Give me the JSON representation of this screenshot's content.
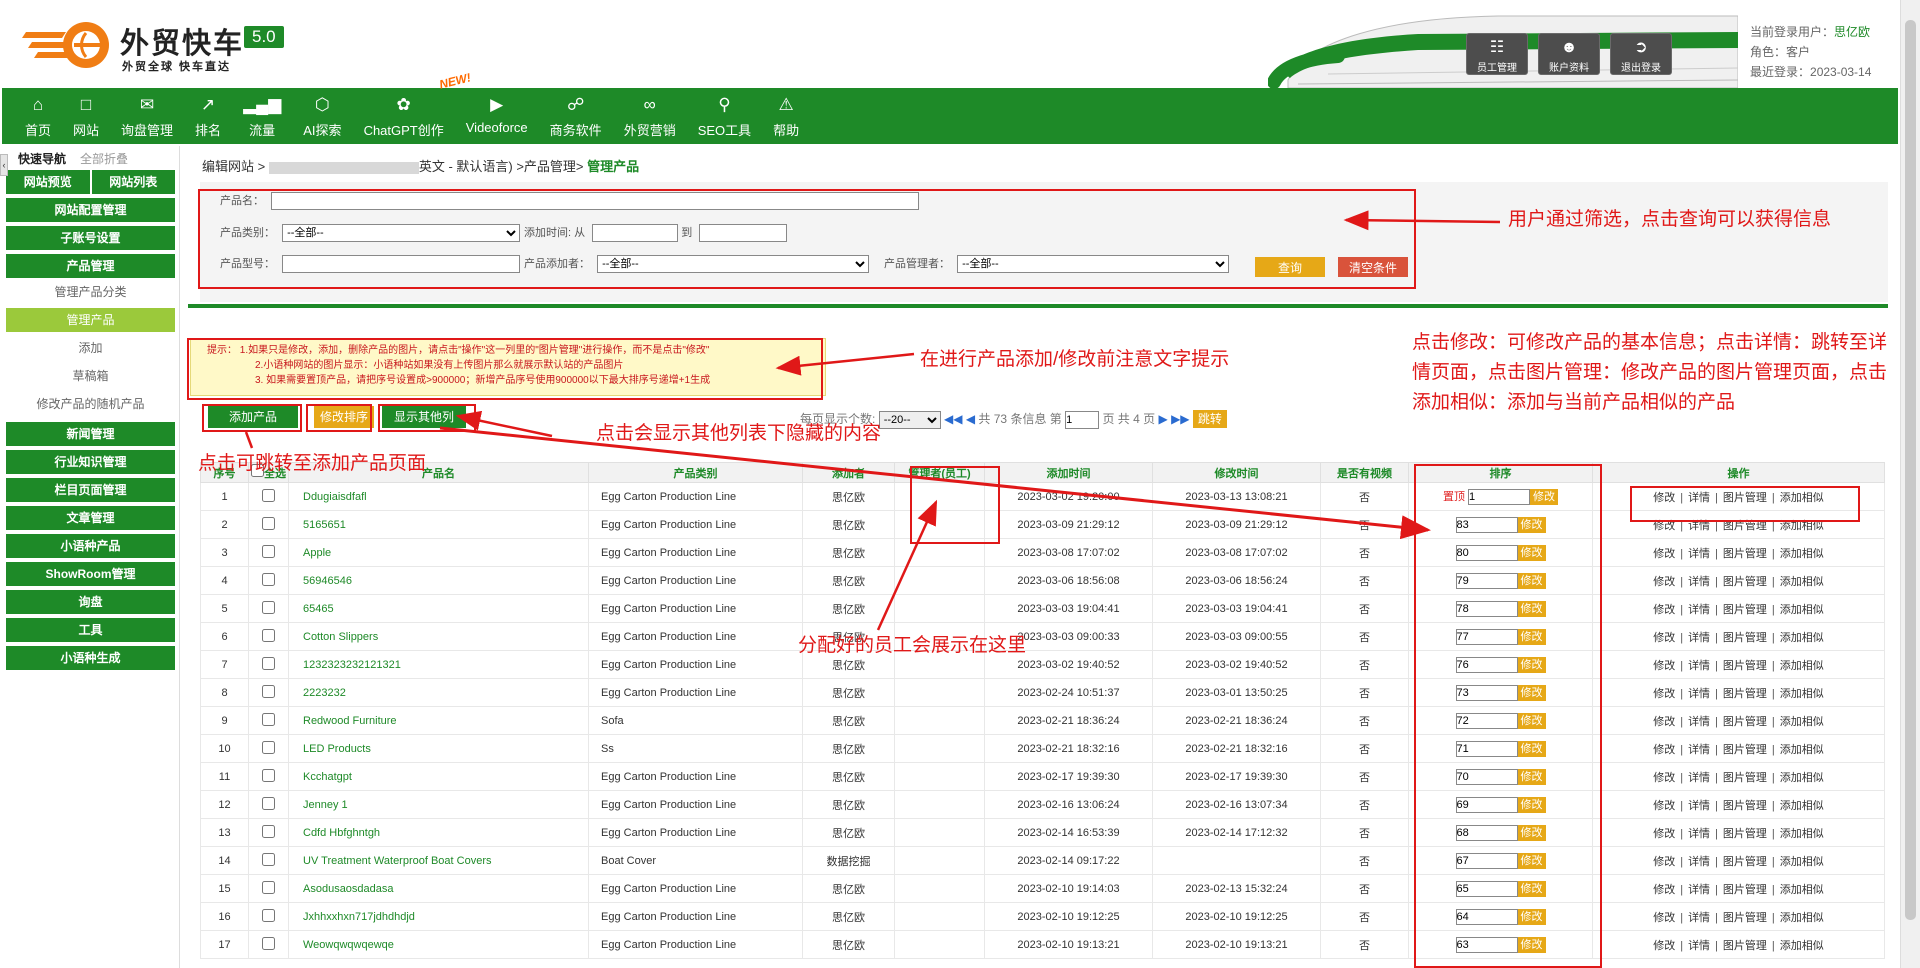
{
  "header": {
    "logo_title": "外贸快车",
    "logo_version": "5.0",
    "logo_slogan": "外贸全球 快车直达",
    "buttons": [
      {
        "label": "员工管理",
        "icon": "staff-icon"
      },
      {
        "label": "账户资料",
        "icon": "user-icon"
      },
      {
        "label": "退出登录",
        "icon": "logout-icon"
      }
    ],
    "user_label": "当前登录用户：",
    "user_value": "思亿欧",
    "role_label": "角色：",
    "role_value": "客户",
    "last_label": "最近登录：",
    "last_value": "2023-03-14"
  },
  "nav": {
    "items": [
      {
        "label": "首页",
        "icon": "home-icon"
      },
      {
        "label": "网站",
        "icon": "monitor-icon"
      },
      {
        "label": "询盘管理",
        "icon": "mail-icon"
      },
      {
        "label": "排名",
        "icon": "ranking-icon"
      },
      {
        "label": "流量",
        "icon": "bar-chart-icon"
      },
      {
        "label": "AI探索",
        "icon": "ai-icon"
      },
      {
        "label": "ChatGPT创作",
        "icon": "chatgpt-icon"
      },
      {
        "label": "Videoforce",
        "icon": "video-icon"
      },
      {
        "label": "商务软件",
        "icon": "business-icon"
      },
      {
        "label": "外贸营销",
        "icon": "marketing-icon"
      },
      {
        "label": "SEO工具",
        "icon": "search-icon"
      },
      {
        "label": "帮助",
        "icon": "help-icon"
      }
    ],
    "new_badge": "NEW!"
  },
  "sidebar": {
    "quick_nav": "快速导航",
    "collapse_all": "全部折叠",
    "twin": [
      "网站预览",
      "网站列表"
    ],
    "items": [
      {
        "label": "网站配置管理",
        "type": "group"
      },
      {
        "label": "子账号设置",
        "type": "group"
      },
      {
        "label": "产品管理",
        "type": "group"
      },
      {
        "label": "管理产品分类",
        "type": "sub"
      },
      {
        "label": "管理产品",
        "type": "active"
      },
      {
        "label": "添加",
        "type": "sub"
      },
      {
        "label": "草稿箱",
        "type": "sub"
      },
      {
        "label": "修改产品的随机产品",
        "type": "sub"
      },
      {
        "label": "新闻管理",
        "type": "group"
      },
      {
        "label": "行业知识管理",
        "type": "group"
      },
      {
        "label": "栏目页面管理",
        "type": "group"
      },
      {
        "label": "文章管理",
        "type": "group"
      },
      {
        "label": "小语种产品",
        "type": "group"
      },
      {
        "label": "ShowRoom管理",
        "type": "group"
      },
      {
        "label": "询盘",
        "type": "group"
      },
      {
        "label": "工具",
        "type": "group"
      },
      {
        "label": "小语种生成",
        "type": "group"
      }
    ]
  },
  "breadcrumb": {
    "prefix": "编辑网站 > ",
    "site_suffix": "英文 - 默认语言) >产品管理> ",
    "current": "管理产品"
  },
  "filter": {
    "name_label": "产品名：",
    "category_label": "产品类别：",
    "category_value": "--全部--",
    "time_label": "添加时间: 从",
    "time_to": "到",
    "model_label": "产品型号：",
    "adder_label": "产品添加者：",
    "adder_value": "--全部--",
    "manager_label": "产品管理者：",
    "manager_value": "--全部--",
    "query_btn": "查询",
    "clear_btn": "清空条件"
  },
  "tip": {
    "line1": "提示：  1.如果只是修改，添加，删除产品的图片，请点击\"操作\"这一列里的\"图片管理\"进行操作，而不是点击\"修改\"",
    "line2": "2.小语种网站的图片显示：小语种站如果没有上传图片那么就展示默认站的产品图片",
    "line3": "3. 如果需要置顶产品，请把序号设置成>900000；新增产品序号使用900000以下最大排序号递增+1生成"
  },
  "toolbar": {
    "add": "添加产品",
    "sort": "修改排序",
    "show_cols": "显示其他列",
    "per_page_label": "每页显示个数:",
    "per_page_value": "--20--",
    "total_text": "共 73 条信息 第",
    "page_value": "1",
    "pages_text": "页 共 4 页",
    "go": "跳转"
  },
  "table": {
    "headers": [
      "序号",
      "全选",
      "产品名",
      "产品类别",
      "添加者",
      "管理者(员工)",
      "添加时间",
      "修改时间",
      "是否有视频",
      "排序",
      "操作"
    ],
    "top_label": "置顶",
    "modify_label": "修改",
    "ops": [
      "修改",
      "详情",
      "图片管理",
      "添加相似"
    ],
    "rows": [
      {
        "no": "1",
        "name": "Ddugiaisdfafl",
        "cat": "Egg Carton Production Line",
        "adder": "思亿欧",
        "added": "2023-03-02 19:20:00",
        "modified": "2023-03-13 13:08:21",
        "video": "否",
        "sort": "1",
        "top": true
      },
      {
        "no": "2",
        "name": "5165651",
        "cat": "Egg Carton Production Line",
        "adder": "思亿欧",
        "added": "2023-03-09 21:29:12",
        "modified": "2023-03-09 21:29:12",
        "video": "否",
        "sort": "83"
      },
      {
        "no": "3",
        "name": "Apple",
        "cat": "Egg Carton Production Line",
        "adder": "思亿欧",
        "added": "2023-03-08 17:07:02",
        "modified": "2023-03-08 17:07:02",
        "video": "否",
        "sort": "80"
      },
      {
        "no": "4",
        "name": "56946546",
        "cat": "Egg Carton Production Line",
        "adder": "思亿欧",
        "added": "2023-03-06 18:56:08",
        "modified": "2023-03-06 18:56:24",
        "video": "否",
        "sort": "79"
      },
      {
        "no": "5",
        "name": "65465",
        "cat": "Egg Carton Production Line",
        "adder": "思亿欧",
        "added": "2023-03-03 19:04:41",
        "modified": "2023-03-03 19:04:41",
        "video": "否",
        "sort": "78"
      },
      {
        "no": "6",
        "name": "Cotton Slippers",
        "cat": "Egg Carton Production Line",
        "adder": "思亿欧",
        "added": "2023-03-03 09:00:33",
        "modified": "2023-03-03 09:00:55",
        "video": "否",
        "sort": "77"
      },
      {
        "no": "7",
        "name": "1232323232121321",
        "cat": "Egg Carton Production Line",
        "adder": "思亿欧",
        "added": "2023-03-02 19:40:52",
        "modified": "2023-03-02 19:40:52",
        "video": "否",
        "sort": "76"
      },
      {
        "no": "8",
        "name": "2223232",
        "cat": "Egg Carton Production Line",
        "adder": "思亿欧",
        "added": "2023-02-24 10:51:37",
        "modified": "2023-03-01 13:50:25",
        "video": "否",
        "sort": "73"
      },
      {
        "no": "9",
        "name": "Redwood Furniture",
        "cat": "Sofa",
        "adder": "思亿欧",
        "added": "2023-02-21 18:36:24",
        "modified": "2023-02-21 18:36:24",
        "video": "否",
        "sort": "72"
      },
      {
        "no": "10",
        "name": "LED Products",
        "cat": "Ss",
        "adder": "思亿欧",
        "added": "2023-02-21 18:32:16",
        "modified": "2023-02-21 18:32:16",
        "video": "否",
        "sort": "71"
      },
      {
        "no": "11",
        "name": "Kcchatgpt",
        "cat": "Egg Carton Production Line",
        "adder": "思亿欧",
        "added": "2023-02-17 19:39:30",
        "modified": "2023-02-17 19:39:30",
        "video": "否",
        "sort": "70"
      },
      {
        "no": "12",
        "name": "Jenney 1",
        "cat": "Egg Carton Production Line",
        "adder": "思亿欧",
        "added": "2023-02-16 13:06:24",
        "modified": "2023-02-16 13:07:34",
        "video": "否",
        "sort": "69"
      },
      {
        "no": "13",
        "name": "Cdfd Hbfghntgh",
        "cat": "Egg Carton Production Line",
        "adder": "思亿欧",
        "added": "2023-02-14 16:53:39",
        "modified": "2023-02-14 17:12:32",
        "video": "否",
        "sort": "68"
      },
      {
        "no": "14",
        "name": "UV Treatment Waterproof Boat Covers",
        "cat": "Boat Cover",
        "adder": "数据挖掘",
        "added": "2023-02-14 09:17:22",
        "modified": "",
        "video": "否",
        "sort": "67"
      },
      {
        "no": "15",
        "name": "Asodusaosdadasa",
        "cat": "Egg Carton Production Line",
        "adder": "思亿欧",
        "added": "2023-02-10 19:14:03",
        "modified": "2023-02-13 15:32:24",
        "video": "否",
        "sort": "65"
      },
      {
        "no": "16",
        "name": "Jxhhxxhxn717jdhdhdjd",
        "cat": "Egg Carton Production Line",
        "adder": "思亿欧",
        "added": "2023-02-10 19:12:25",
        "modified": "2023-02-10 19:12:25",
        "video": "否",
        "sort": "64"
      },
      {
        "no": "17",
        "name": "Weowqwqwqewqe",
        "cat": "Egg Carton Production Line",
        "adder": "思亿欧",
        "added": "2023-02-10 19:13:21",
        "modified": "2023-02-10 19:13:21",
        "video": "否",
        "sort": "63"
      }
    ]
  },
  "annotations": {
    "filter_note": "用户通过筛选，点击查询可以获得信息",
    "tip_note": "在进行产品添加/修改前注意文字提示",
    "ops_note": "点击修改：可修改产品的基本信息；点击详情：跳转至详情页面，点击图片管理：修改产品的图片管理页面，点击添加相似：添加与当前产品相似的产品",
    "show_cols_note": "点击会显示其他列表下隐藏的内容",
    "add_note": "点击可跳转至添加产品页面",
    "staff_note": "分配好的员工会展示在这里"
  },
  "colors": {
    "brand_green": "#1e8a28",
    "accent_orange": "#e6a817",
    "annotation_red": "#e01818"
  }
}
